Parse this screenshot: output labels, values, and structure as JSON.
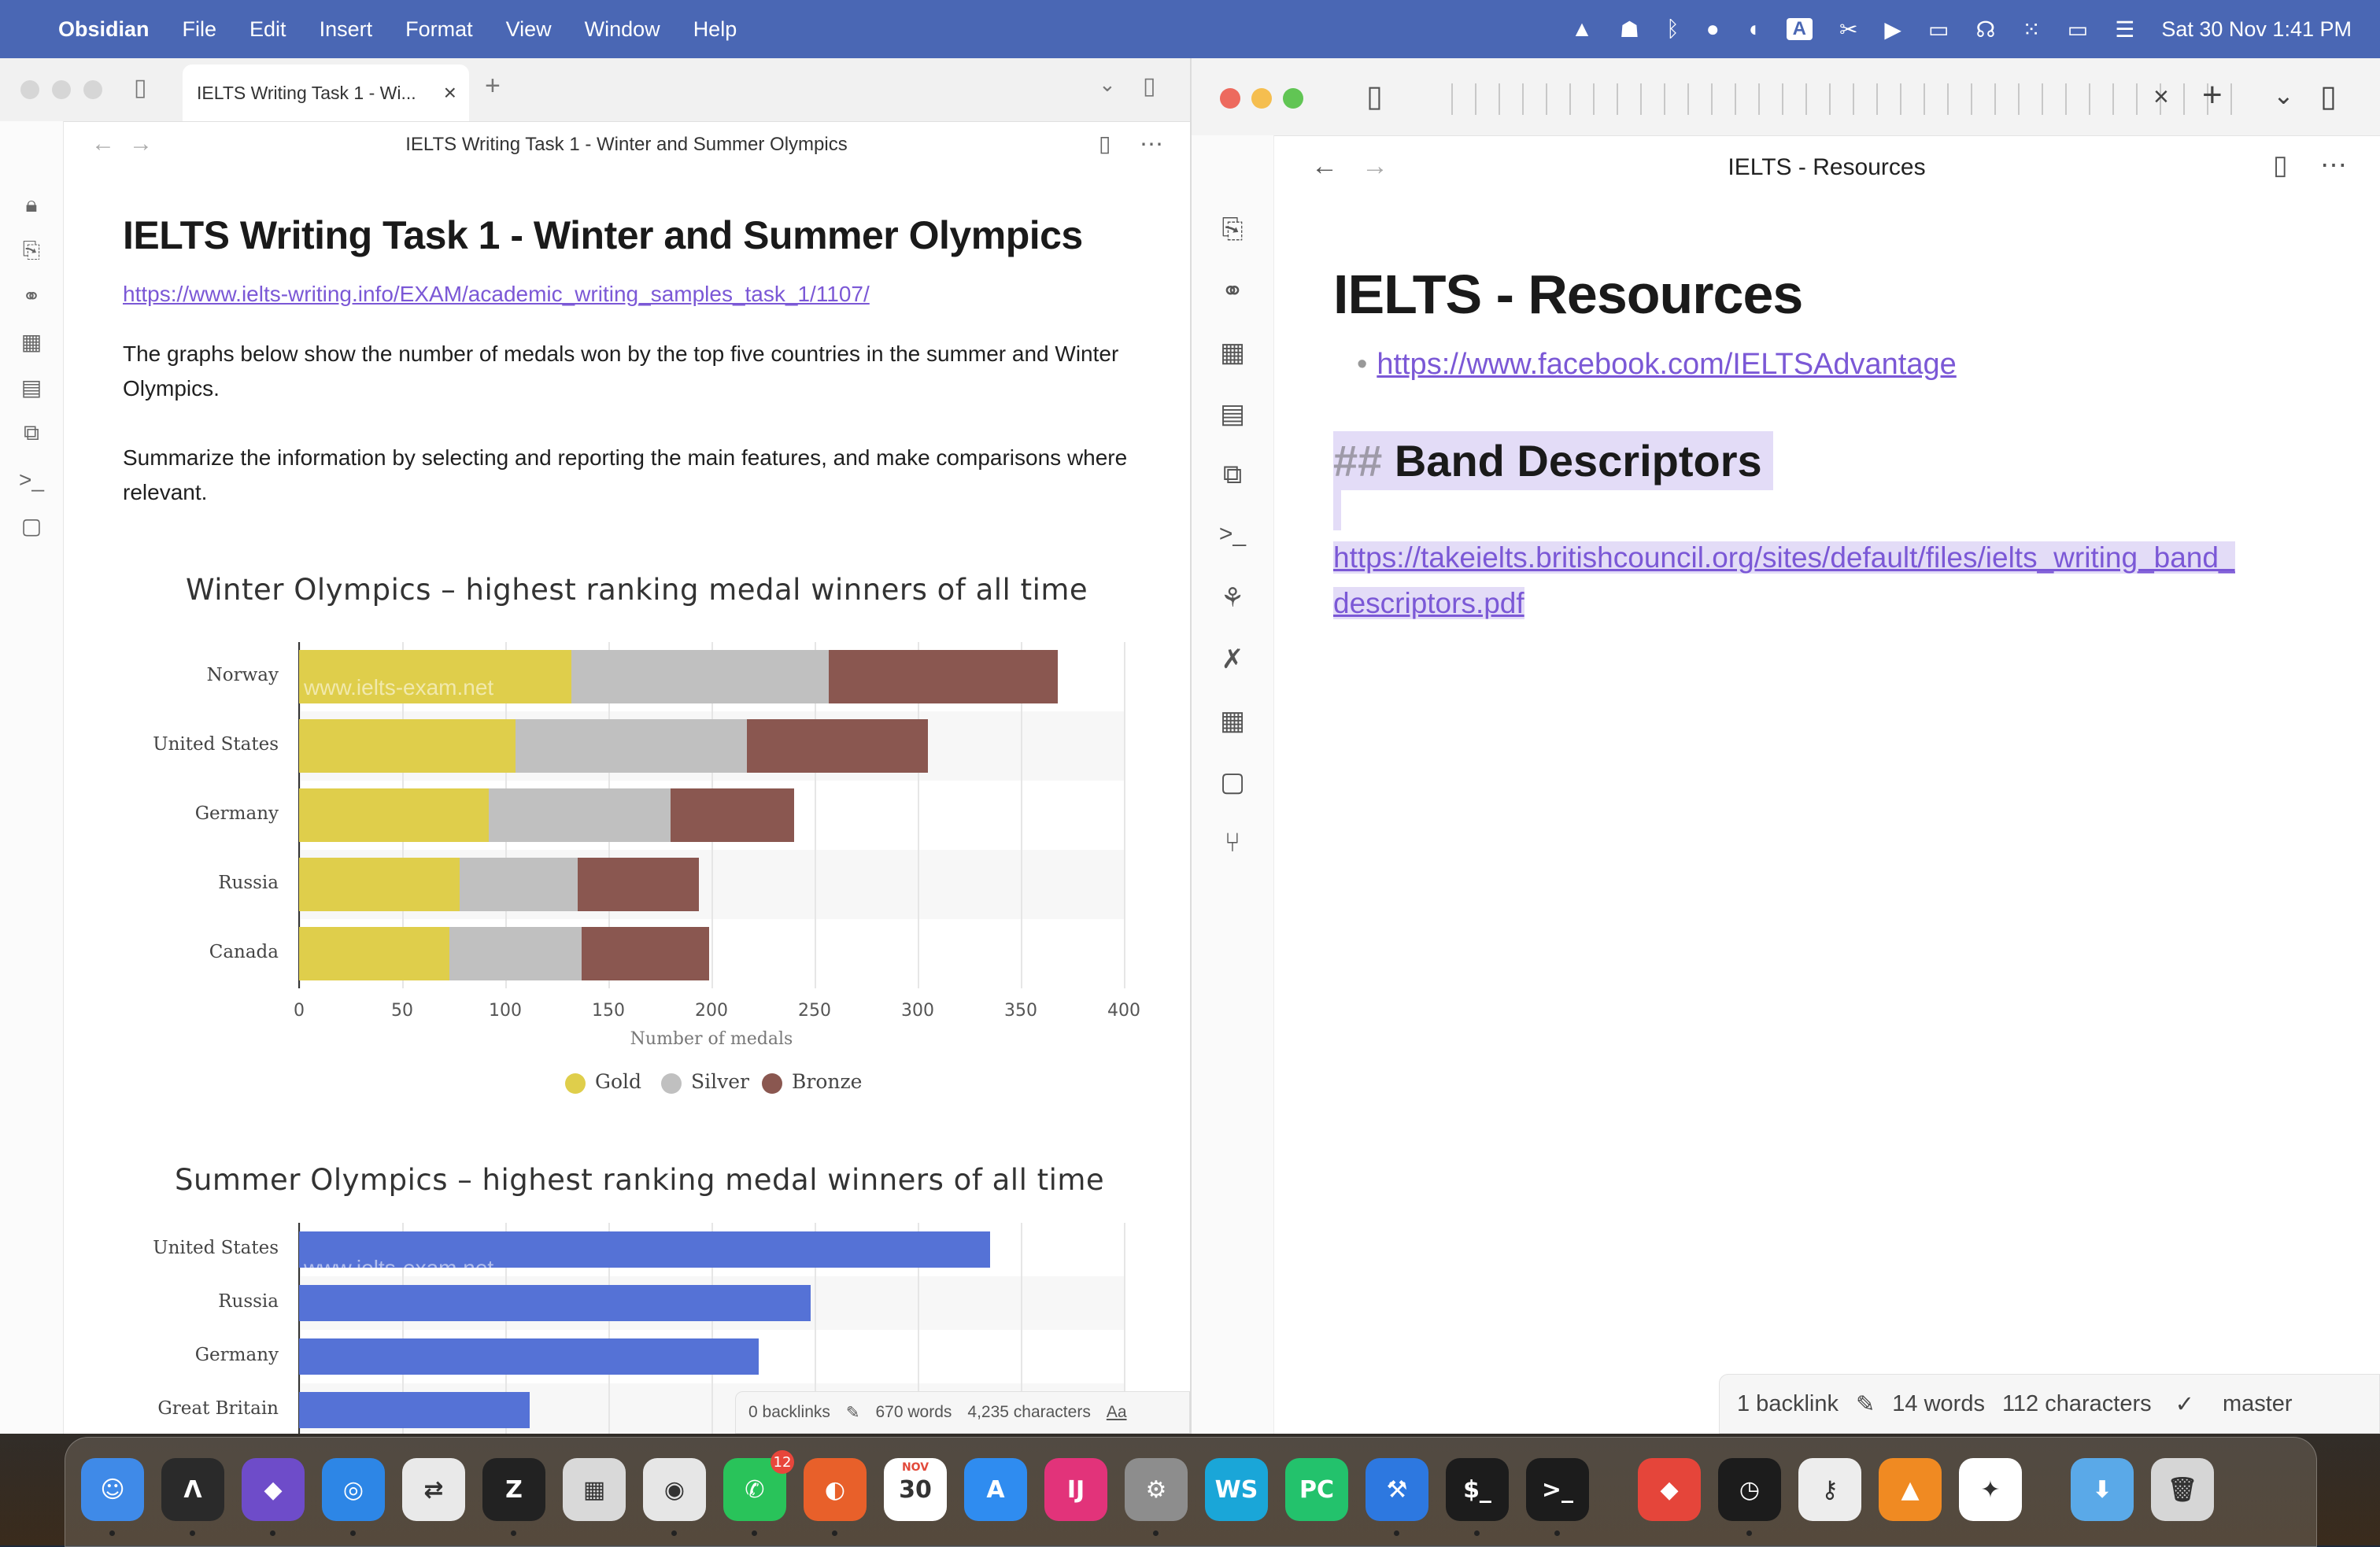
{
  "menubar": {
    "app_name": "Obsidian",
    "menus": [
      "File",
      "Edit",
      "Insert",
      "Format",
      "View",
      "Window",
      "Help"
    ],
    "datetime": "Sat 30 Nov  1:41 PM",
    "status_icons": [
      "vlc-icon",
      "ghost-icon",
      "bluetooth-icon",
      "avatar-icon",
      "elephant-icon",
      "input-a-icon",
      "scissors-icon",
      "play-icon",
      "display-icon",
      "headphones-icon",
      "grid-icon",
      "battery-icon",
      "control-center-icon"
    ],
    "input_source_label": "A"
  },
  "left": {
    "tab_title": "IELTS Writing Task 1 - Wi...",
    "nav_title": "IELTS Writing Task 1 - Winter and Summer Olympics",
    "heading": "IELTS Writing Task 1 - Winter and Summer Olympics",
    "link": "https://www.ielts-writing.info/EXAM/academic_writing_samples_task_1/1107/",
    "para1": "The graphs below show the number of medals won by the top five countries in the summer and Winter Olympics.",
    "para2": "Summarize the information by selecting and reporting the main features, and make comparisons where relevant.",
    "status": {
      "backlinks": "0 backlinks",
      "words": "670 words",
      "characters": "4,235 characters",
      "mode": "Aa"
    }
  },
  "chart_data": [
    {
      "type": "bar",
      "orientation": "horizontal",
      "stacked": true,
      "title": "Winter Olympics – highest ranking medal winners of all time",
      "categories": [
        "Norway",
        "United States",
        "Germany",
        "Russia",
        "Canada"
      ],
      "series": [
        {
          "name": "Gold",
          "color": "#dfce4b",
          "values": [
            132,
            105,
            92,
            78,
            73
          ]
        },
        {
          "name": "Silver",
          "color": "#c0c0c0",
          "values": [
            125,
            112,
            88,
            57,
            64
          ]
        },
        {
          "name": "Bronze",
          "color": "#8a5750",
          "values": [
            111,
            88,
            60,
            59,
            62
          ]
        }
      ],
      "xlabel": "Number of medals",
      "xlim": [
        0,
        400
      ],
      "xticks": [
        0,
        50,
        100,
        150,
        200,
        250,
        300,
        350,
        400
      ],
      "watermark": "www.ielts-exam.net",
      "legend": "bottom"
    },
    {
      "type": "bar",
      "orientation": "horizontal",
      "title": "Summer Olympics – highest ranking medal winners of all time",
      "categories": [
        "United States",
        "Russia",
        "Germany",
        "Great Britain"
      ],
      "series": [
        {
          "color": "#5572d6",
          "values": [
            335,
            248,
            223,
            112
          ]
        }
      ],
      "xlim": [
        0,
        400
      ],
      "watermark": "www.ielts-exam.net"
    }
  ],
  "right": {
    "nav_title": "IELTS - Resources",
    "heading": "IELTS - Resources",
    "bullet_link": "https://www.facebook.com/IELTSAdvantage",
    "h2_marker": "##",
    "h2_text": "Band Descriptors",
    "pdf_link_line1": "https://takeielts.britishcouncil.org/sites/default/files/ielts_writing_band_",
    "pdf_link_line2": "descriptors.pdf",
    "status": {
      "backlinks": "1 backlink",
      "words": "14 words",
      "characters": "112 characters",
      "branch": "master"
    }
  },
  "dock": {
    "apps": [
      {
        "name": "Finder",
        "glyph": "☺",
        "color": "#3f8ae8"
      },
      {
        "name": "Alacritty",
        "glyph": "Λ",
        "color": "#2a2a2a"
      },
      {
        "name": "Obsidian",
        "glyph": "◆",
        "color": "#6e4cc9"
      },
      {
        "name": "Safari",
        "glyph": "◎",
        "color": "#2d86e6"
      },
      {
        "name": "Remote Desktop",
        "glyph": "⇄",
        "color": "#e9e9e9"
      },
      {
        "name": "Zed",
        "glyph": "Z",
        "color": "#222"
      },
      {
        "name": "Launchpad",
        "glyph": "▦",
        "color": "#d9d9d9"
      },
      {
        "name": "Chrome",
        "glyph": "◉",
        "color": "#e6e6e6"
      },
      {
        "name": "WhatsApp",
        "glyph": "✆",
        "color": "#29c35a",
        "badge": "12"
      },
      {
        "name": "Firefox",
        "glyph": "◐",
        "color": "#e8602a"
      },
      {
        "name": "Calendar",
        "glyph": "30",
        "color": "#ffffff",
        "label": "NOV"
      },
      {
        "name": "App Store",
        "glyph": "A",
        "color": "#2f8cf0"
      },
      {
        "name": "IntelliJ",
        "glyph": "IJ",
        "color": "#e2337a"
      },
      {
        "name": "System Settings",
        "glyph": "⚙",
        "color": "#8d8d8d"
      },
      {
        "name": "WebStorm",
        "glyph": "WS",
        "color": "#1aa6d8"
      },
      {
        "name": "PyCharm",
        "glyph": "PC",
        "color": "#23c26c"
      },
      {
        "name": "Xcode",
        "glyph": "⚒",
        "color": "#2d78e0"
      },
      {
        "name": "Terminal Green",
        "glyph": "$_",
        "color": "#1c1c1c"
      },
      {
        "name": "Terminal",
        "glyph": ">_",
        "color": "#1c1c1c"
      },
      {
        "name": "AnyDesk",
        "glyph": "◆",
        "color": "#e5453a"
      },
      {
        "name": "Clock",
        "glyph": "◷",
        "color": "#1c1c1c"
      },
      {
        "name": "Passwords",
        "glyph": "⚷",
        "color": "#ededed"
      },
      {
        "name": "VLC",
        "glyph": "▲",
        "color": "#f08a22"
      },
      {
        "name": "Messenger",
        "glyph": "✦",
        "color": "#ffffff"
      },
      {
        "name": "Downloads",
        "glyph": "⬇",
        "color": "#5aa9e8"
      },
      {
        "name": "Trash",
        "glyph": "🗑",
        "color": "#d6d6d6"
      }
    ]
  }
}
